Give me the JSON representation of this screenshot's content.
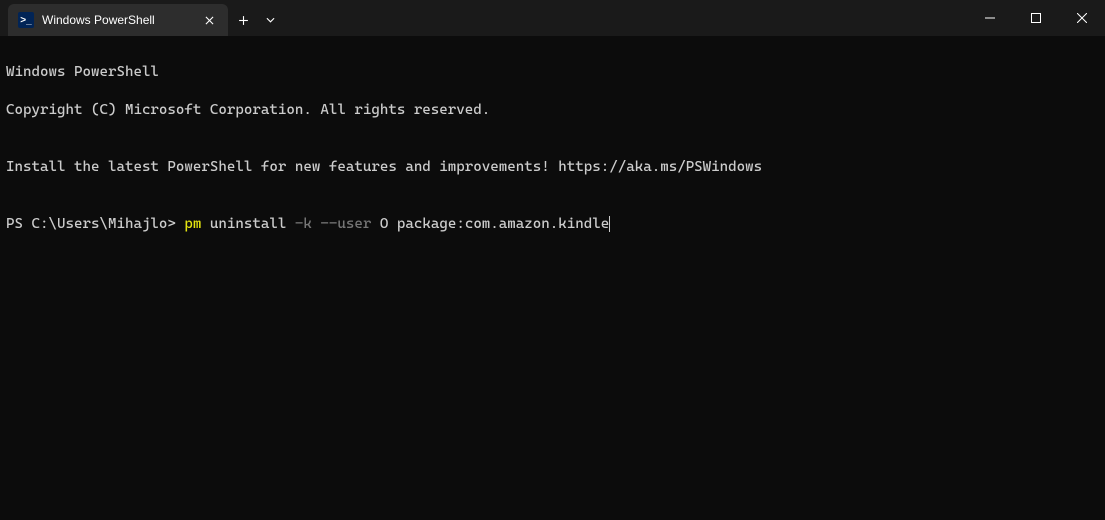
{
  "tab": {
    "title": "Windows PowerShell",
    "icon_text": ">_"
  },
  "terminal": {
    "line1": "Windows PowerShell",
    "line2": "Copyright (C) Microsoft Corporation. All rights reserved.",
    "line3": "",
    "line4": "Install the latest PowerShell for new features and improvements! https://aka.ms/PSWindows",
    "line5": "",
    "prompt": "PS C:\\Users\\Mihajlo> ",
    "cmd_yellow": "pm",
    "cmd_white1": " uninstall ",
    "cmd_gray": "-k --user",
    "cmd_white2": " O package:com.amazon.kindle"
  }
}
